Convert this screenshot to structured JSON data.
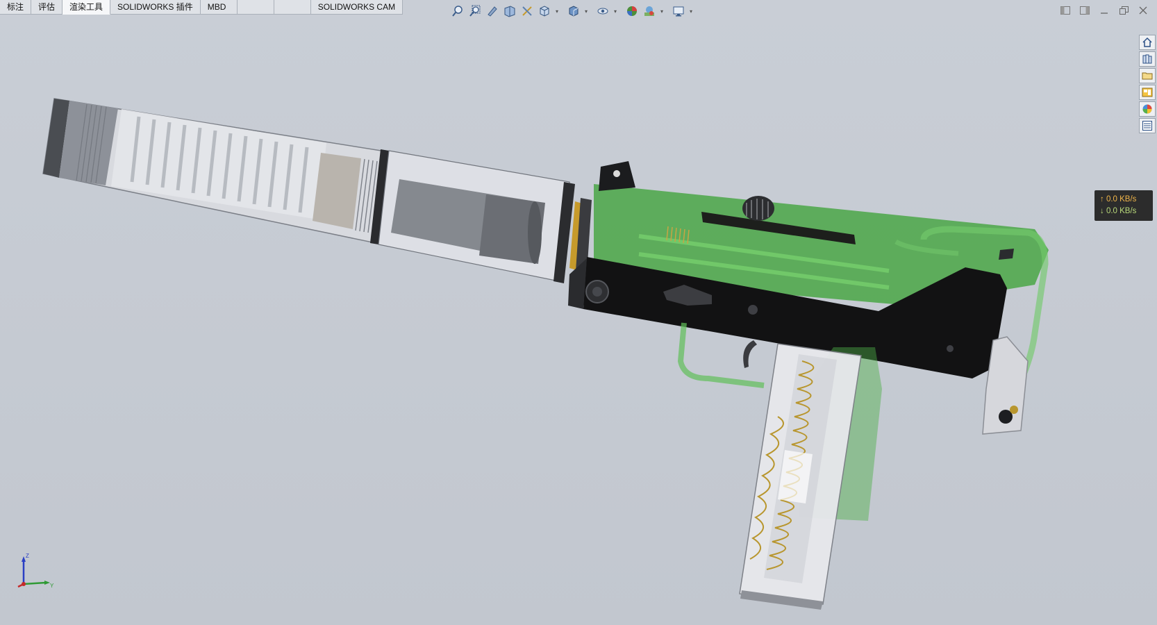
{
  "tabs": [
    {
      "label": "标注",
      "active": false
    },
    {
      "label": "评估",
      "active": false
    },
    {
      "label": "渲染工具",
      "active": true
    },
    {
      "label": "SOLIDWORKS 插件",
      "active": false
    },
    {
      "label": "MBD",
      "active": false
    },
    {
      "label": "",
      "active": false
    },
    {
      "label": "",
      "active": false
    },
    {
      "label": "SOLIDWORKS CAM",
      "active": false
    }
  ],
  "hud_icons": [
    "zoom-to-fit-icon",
    "zoom-to-area-icon",
    "previous-view-icon",
    "section-view-icon",
    "dynamic-annotation-icon",
    "view-orientation-icon",
    "display-style-icon",
    "hide-show-items-icon",
    "edit-appearance-icon",
    "apply-scene-icon",
    "view-settings-icon"
  ],
  "window_controls": [
    "tile-left-icon",
    "tile-right-icon",
    "minimize-icon",
    "restore-icon",
    "close-icon"
  ],
  "task_pane": [
    "home-icon",
    "design-library-icon",
    "file-explorer-icon",
    "view-palette-icon",
    "appearances-icon",
    "custom-properties-icon"
  ],
  "network": {
    "upload": "↑ 0.0 KB/s",
    "download": "↓ 0.0 KB/s"
  },
  "triad": {
    "axis_z": "Z",
    "axis_y": "Y"
  },
  "colors": {
    "viewport_bg": "#c5cad2",
    "receiver_green": "#3fa33a",
    "lower_black": "#111111",
    "spring_gold": "#b8962e"
  }
}
